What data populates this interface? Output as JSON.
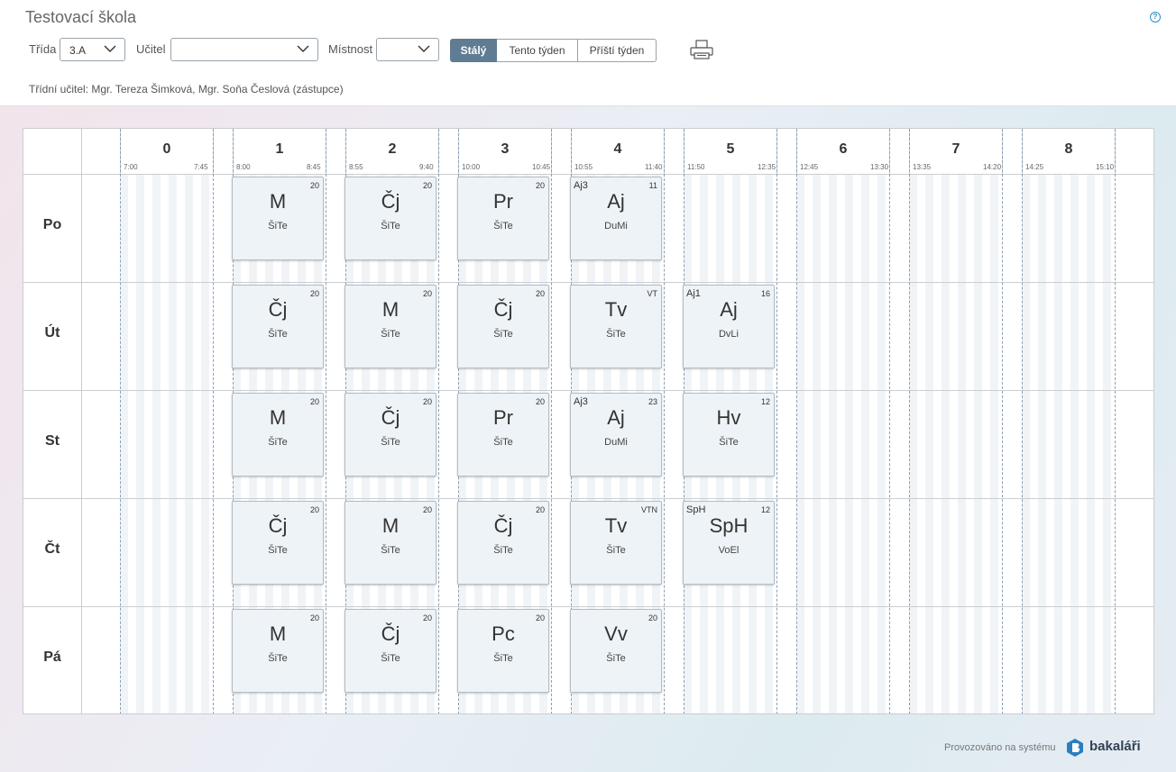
{
  "header": {
    "school_name": "Testovací škola",
    "help_icon": "?",
    "filters": {
      "class_label": "Třída",
      "class_value": "3.A",
      "teacher_label": "Učitel",
      "teacher_value": "",
      "room_label": "Místnost",
      "room_value": ""
    },
    "view_buttons": [
      {
        "label": "Stálý",
        "active": true
      },
      {
        "label": "Tento týden",
        "active": false
      },
      {
        "label": "Příští týden",
        "active": false
      }
    ],
    "print_icon": "printer-icon",
    "class_teacher": "Třídní učitel: Mgr. Tereza Šimková, Mgr. Soňa Česlová (zástupce)"
  },
  "hours": [
    {
      "num": "0",
      "start": "7:00",
      "end": "7:45"
    },
    {
      "num": "1",
      "start": "8:00",
      "end": "8:45"
    },
    {
      "num": "2",
      "start": "8:55",
      "end": "9:40"
    },
    {
      "num": "3",
      "start": "10:00",
      "end": "10:45"
    },
    {
      "num": "4",
      "start": "10:55",
      "end": "11:40"
    },
    {
      "num": "5",
      "start": "11:50",
      "end": "12:35"
    },
    {
      "num": "6",
      "start": "12:45",
      "end": "13:30"
    },
    {
      "num": "7",
      "start": "13:35",
      "end": "14:20"
    },
    {
      "num": "8",
      "start": "14:25",
      "end": "15:10"
    }
  ],
  "days": [
    {
      "name": "Po",
      "lessons": [
        {
          "hour": 1,
          "subject": "M",
          "teacher": "ŠiTe",
          "room": "20",
          "group": ""
        },
        {
          "hour": 2,
          "subject": "Čj",
          "teacher": "ŠiTe",
          "room": "20",
          "group": ""
        },
        {
          "hour": 3,
          "subject": "Pr",
          "teacher": "ŠiTe",
          "room": "20",
          "group": ""
        },
        {
          "hour": 4,
          "subject": "Aj",
          "teacher": "DuMi",
          "room": "11",
          "group": "Aj3"
        }
      ]
    },
    {
      "name": "Út",
      "lessons": [
        {
          "hour": 1,
          "subject": "Čj",
          "teacher": "ŠiTe",
          "room": "20",
          "group": ""
        },
        {
          "hour": 2,
          "subject": "M",
          "teacher": "ŠiTe",
          "room": "20",
          "group": ""
        },
        {
          "hour": 3,
          "subject": "Čj",
          "teacher": "ŠiTe",
          "room": "20",
          "group": ""
        },
        {
          "hour": 4,
          "subject": "Tv",
          "teacher": "ŠiTe",
          "room": "VT",
          "group": ""
        },
        {
          "hour": 5,
          "subject": "Aj",
          "teacher": "DvLi",
          "room": "16",
          "group": "Aj1"
        }
      ]
    },
    {
      "name": "St",
      "lessons": [
        {
          "hour": 1,
          "subject": "M",
          "teacher": "ŠiTe",
          "room": "20",
          "group": ""
        },
        {
          "hour": 2,
          "subject": "Čj",
          "teacher": "ŠiTe",
          "room": "20",
          "group": ""
        },
        {
          "hour": 3,
          "subject": "Pr",
          "teacher": "ŠiTe",
          "room": "20",
          "group": ""
        },
        {
          "hour": 4,
          "subject": "Aj",
          "teacher": "DuMi",
          "room": "23",
          "group": "Aj3"
        },
        {
          "hour": 5,
          "subject": "Hv",
          "teacher": "ŠiTe",
          "room": "12",
          "group": ""
        }
      ]
    },
    {
      "name": "Čt",
      "lessons": [
        {
          "hour": 1,
          "subject": "Čj",
          "teacher": "ŠiTe",
          "room": "20",
          "group": ""
        },
        {
          "hour": 2,
          "subject": "M",
          "teacher": "ŠiTe",
          "room": "20",
          "group": ""
        },
        {
          "hour": 3,
          "subject": "Čj",
          "teacher": "ŠiTe",
          "room": "20",
          "group": ""
        },
        {
          "hour": 4,
          "subject": "Tv",
          "teacher": "ŠiTe",
          "room": "VTN",
          "group": ""
        },
        {
          "hour": 5,
          "subject": "SpH",
          "teacher": "VoEl",
          "room": "12",
          "group": "SpH"
        }
      ]
    },
    {
      "name": "Pá",
      "lessons": [
        {
          "hour": 1,
          "subject": "M",
          "teacher": "ŠiTe",
          "room": "20",
          "group": ""
        },
        {
          "hour": 2,
          "subject": "Čj",
          "teacher": "ŠiTe",
          "room": "20",
          "group": ""
        },
        {
          "hour": 3,
          "subject": "Pc",
          "teacher": "ŠiTe",
          "room": "20",
          "group": ""
        },
        {
          "hour": 4,
          "subject": "Vv",
          "teacher": "ŠiTe",
          "room": "20",
          "group": ""
        }
      ]
    }
  ],
  "footer": {
    "powered_by": "Provozováno na systému",
    "brand": "bakaláři",
    "logo_icon": "bakalari-logo-icon"
  }
}
